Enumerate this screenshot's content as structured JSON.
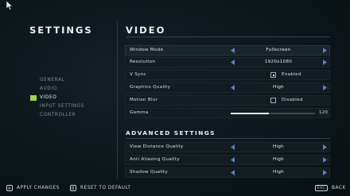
{
  "header": {
    "title": "SETTINGS"
  },
  "nav": {
    "items": [
      {
        "label": "GENERAL",
        "active": false
      },
      {
        "label": "AUDIO",
        "active": false
      },
      {
        "label": "VIDEO",
        "active": true
      },
      {
        "label": "INPUT SETTINGS",
        "active": false
      },
      {
        "label": "CONTROLLER",
        "active": false
      }
    ]
  },
  "video": {
    "title": "VIDEO",
    "window_mode": {
      "label": "Window Mode",
      "value": "Fullscreen"
    },
    "resolution": {
      "label": "Resolution",
      "value": "1920x1080"
    },
    "vsync": {
      "label": "V Sync",
      "state_label": "Enabled",
      "checked": true
    },
    "graphics_quality": {
      "label": "Graphics Quality",
      "value": "High"
    },
    "motion_blur": {
      "label": "Motion Blur",
      "state_label": "Disabled",
      "checked": false
    },
    "gamma": {
      "label": "Gamma",
      "value": "120",
      "fill_fraction": 0.45
    }
  },
  "advanced": {
    "title": "ADVANCED SETTINGS",
    "view_distance": {
      "label": "View Distance Quality",
      "value": "High"
    },
    "anti_aliasing": {
      "label": "Anti Aliasing Quality",
      "value": "High"
    },
    "shadow": {
      "label": "Shadow Quality",
      "value": "High"
    }
  },
  "footer": {
    "apply": {
      "key": "A",
      "label": "APPLY CHANGES"
    },
    "reset": {
      "key": "B",
      "label": "RESET TO DEFAULT"
    },
    "back": {
      "key": "ESC",
      "label": "BACK"
    }
  },
  "colors": {
    "accent": "#9bd84a",
    "arrow": "#5a80c9",
    "background": "#0c1519"
  }
}
